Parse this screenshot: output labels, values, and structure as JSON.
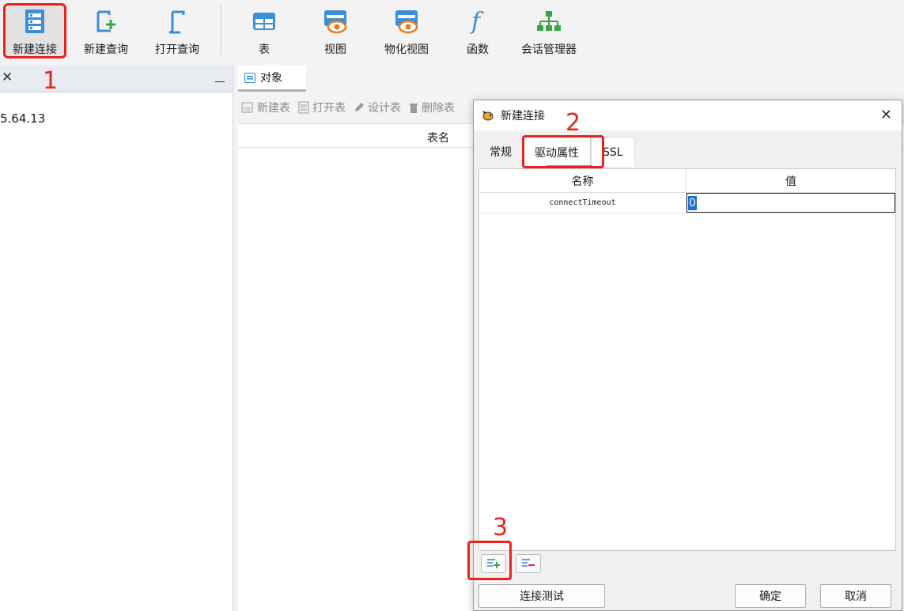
{
  "toolbar": {
    "buttons": [
      {
        "label": "新建连接",
        "icon": "database-server-icon"
      },
      {
        "label": "新建查询",
        "icon": "new-query-icon"
      },
      {
        "label": "打开查询",
        "icon": "open-query-icon"
      },
      {
        "label": "表",
        "icon": "table-icon"
      },
      {
        "label": "视图",
        "icon": "view-icon"
      },
      {
        "label": "物化视图",
        "icon": "materialized-view-icon"
      },
      {
        "label": "函数",
        "icon": "function-icon"
      },
      {
        "label": "会话管理器",
        "icon": "session-manager-icon"
      }
    ]
  },
  "left_panel": {
    "tree_item": "5.64.13"
  },
  "objects": {
    "tab_label": "对象",
    "tools": [
      "新建表",
      "打开表",
      "设计表",
      "删除表"
    ],
    "column_header": "表名"
  },
  "annotations": [
    "1",
    "2",
    "3"
  ],
  "dialog": {
    "title": "新建连接",
    "tabs": [
      "常规",
      "驱动属性",
      "SSL"
    ],
    "active_tab": "驱动属性",
    "table": {
      "headers": [
        "名称",
        "值"
      ],
      "rows": [
        {
          "name": "connectTimeout",
          "value": "0"
        }
      ]
    },
    "buttons": {
      "test": "连接测试",
      "ok": "确定",
      "cancel": "取消"
    }
  },
  "colors": {
    "annotation_red": "#e8231f",
    "accent_blue": "#2f86d6",
    "accent_green": "#3aa544"
  }
}
